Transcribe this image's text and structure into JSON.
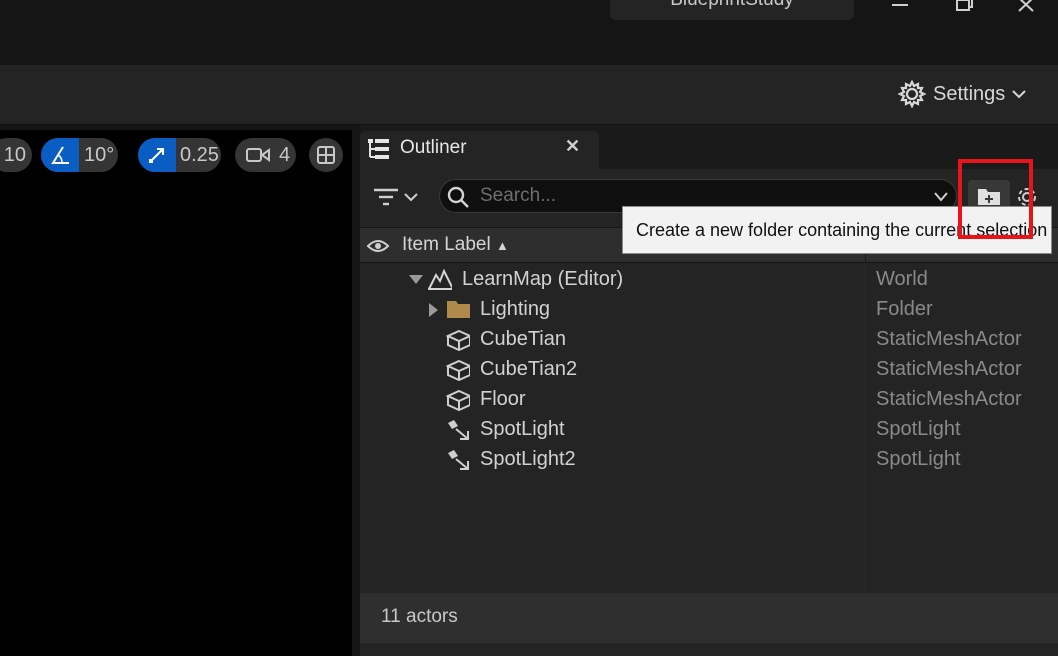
{
  "titlebar": {
    "project_name": "BlueprintStudy"
  },
  "toolbar": {
    "settings_label": "Settings"
  },
  "viewport": {
    "grid_snap_value": "10",
    "rotation_snap_value": "10°",
    "scale_snap_value": "0.25",
    "camera_speed_value": "4"
  },
  "outliner": {
    "tab_title": "Outliner",
    "search_placeholder": "Search...",
    "column_item_label": "Item Label",
    "rows": [
      {
        "label": "LearnMap (Editor)",
        "type": "World"
      },
      {
        "label": "Lighting",
        "type": "Folder"
      },
      {
        "label": "CubeTian",
        "type": "StaticMeshActor"
      },
      {
        "label": "CubeTian2",
        "type": "StaticMeshActor"
      },
      {
        "label": "Floor",
        "type": "StaticMeshActor"
      },
      {
        "label": "SpotLight",
        "type": "SpotLight"
      },
      {
        "label": "SpotLight2",
        "type": "SpotLight"
      }
    ],
    "footer_count": "11 actors"
  },
  "tooltip": {
    "text": "Create a new folder containing the current selection"
  },
  "colors": {
    "accent_blue": "#0a5dc2",
    "highlight_red": "#e8141a",
    "folder_tan": "#b08a4a"
  }
}
